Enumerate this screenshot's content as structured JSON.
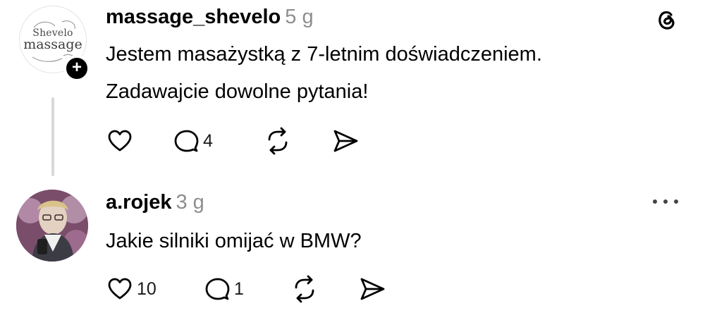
{
  "posts": [
    {
      "username": "massage_shevelo",
      "time": "5 g",
      "avatar_logo_top": "Shevelo",
      "avatar_logo_main": "massage",
      "text_lines": [
        "Jestem masażystką z 7-letnim doświadczeniem.",
        "Zadawajcie dowolne pytania!"
      ],
      "likes": "",
      "replies": "4"
    },
    {
      "username": "a.rojek",
      "time": "3 g",
      "text_lines": [
        "Jakie silniki omijać w BMW?"
      ],
      "likes": "10",
      "replies": "1"
    }
  ],
  "icons": {
    "app": "threads-logo-icon",
    "follow": "plus-icon",
    "like": "heart-icon",
    "reply": "comment-icon",
    "repost": "repost-icon",
    "share": "send-icon",
    "more": "more-options-icon"
  }
}
